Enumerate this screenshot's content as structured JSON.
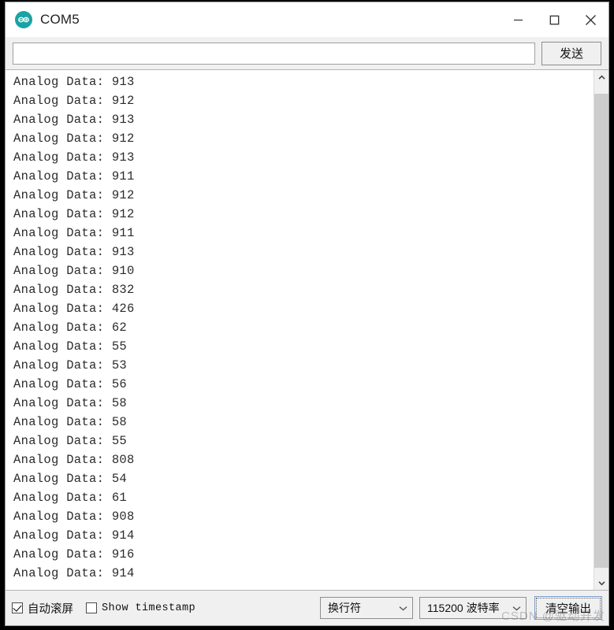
{
  "window": {
    "title": "COM5",
    "app_icon": "arduino-logo-icon",
    "minimize_label": "—",
    "maximize_label": "□",
    "close_label": "✕"
  },
  "send_row": {
    "input_value": "",
    "input_placeholder": "",
    "send_button_label": "发送"
  },
  "console": {
    "prefix": "Analog Data: ",
    "lines": [
      "Analog Data: 913",
      "Analog Data: 912",
      "Analog Data: 913",
      "Analog Data: 912",
      "Analog Data: 913",
      "Analog Data: 911",
      "Analog Data: 912",
      "Analog Data: 912",
      "Analog Data: 911",
      "Analog Data: 913",
      "Analog Data: 910",
      "Analog Data: 832",
      "Analog Data: 426",
      "Analog Data: 62",
      "Analog Data: 55",
      "Analog Data: 53",
      "Analog Data: 56",
      "Analog Data: 58",
      "Analog Data: 58",
      "Analog Data: 55",
      "Analog Data: 808",
      "Analog Data: 54",
      "Analog Data: 61",
      "Analog Data: 908",
      "Analog Data: 914",
      "Analog Data: 916",
      "Analog Data: 914"
    ],
    "values": [
      913,
      912,
      913,
      912,
      913,
      911,
      912,
      912,
      911,
      913,
      910,
      832,
      426,
      62,
      55,
      53,
      56,
      58,
      58,
      55,
      808,
      54,
      61,
      908,
      914,
      916,
      914
    ]
  },
  "scrollbar": {
    "up_arrow": "chevron-up-icon",
    "down_arrow": "chevron-down-icon"
  },
  "bottom_bar": {
    "autoscroll_label": "自动滚屏",
    "autoscroll_checked": true,
    "timestamp_label": "Show timestamp",
    "timestamp_checked": false,
    "newline_value": "换行符",
    "baud_value": "115200 波特率",
    "clear_button_label": "清空输出"
  },
  "watermark": {
    "text": "CSDN @驱动开发"
  },
  "colors": {
    "titlebar_bg": "#ffffff",
    "chrome_bg": "#f0f0f0",
    "console_bg": "#ffffff",
    "console_text": "#2b2b2b",
    "icon_teal": "#1aa3a3",
    "focus_border": "#7a9fd1"
  }
}
